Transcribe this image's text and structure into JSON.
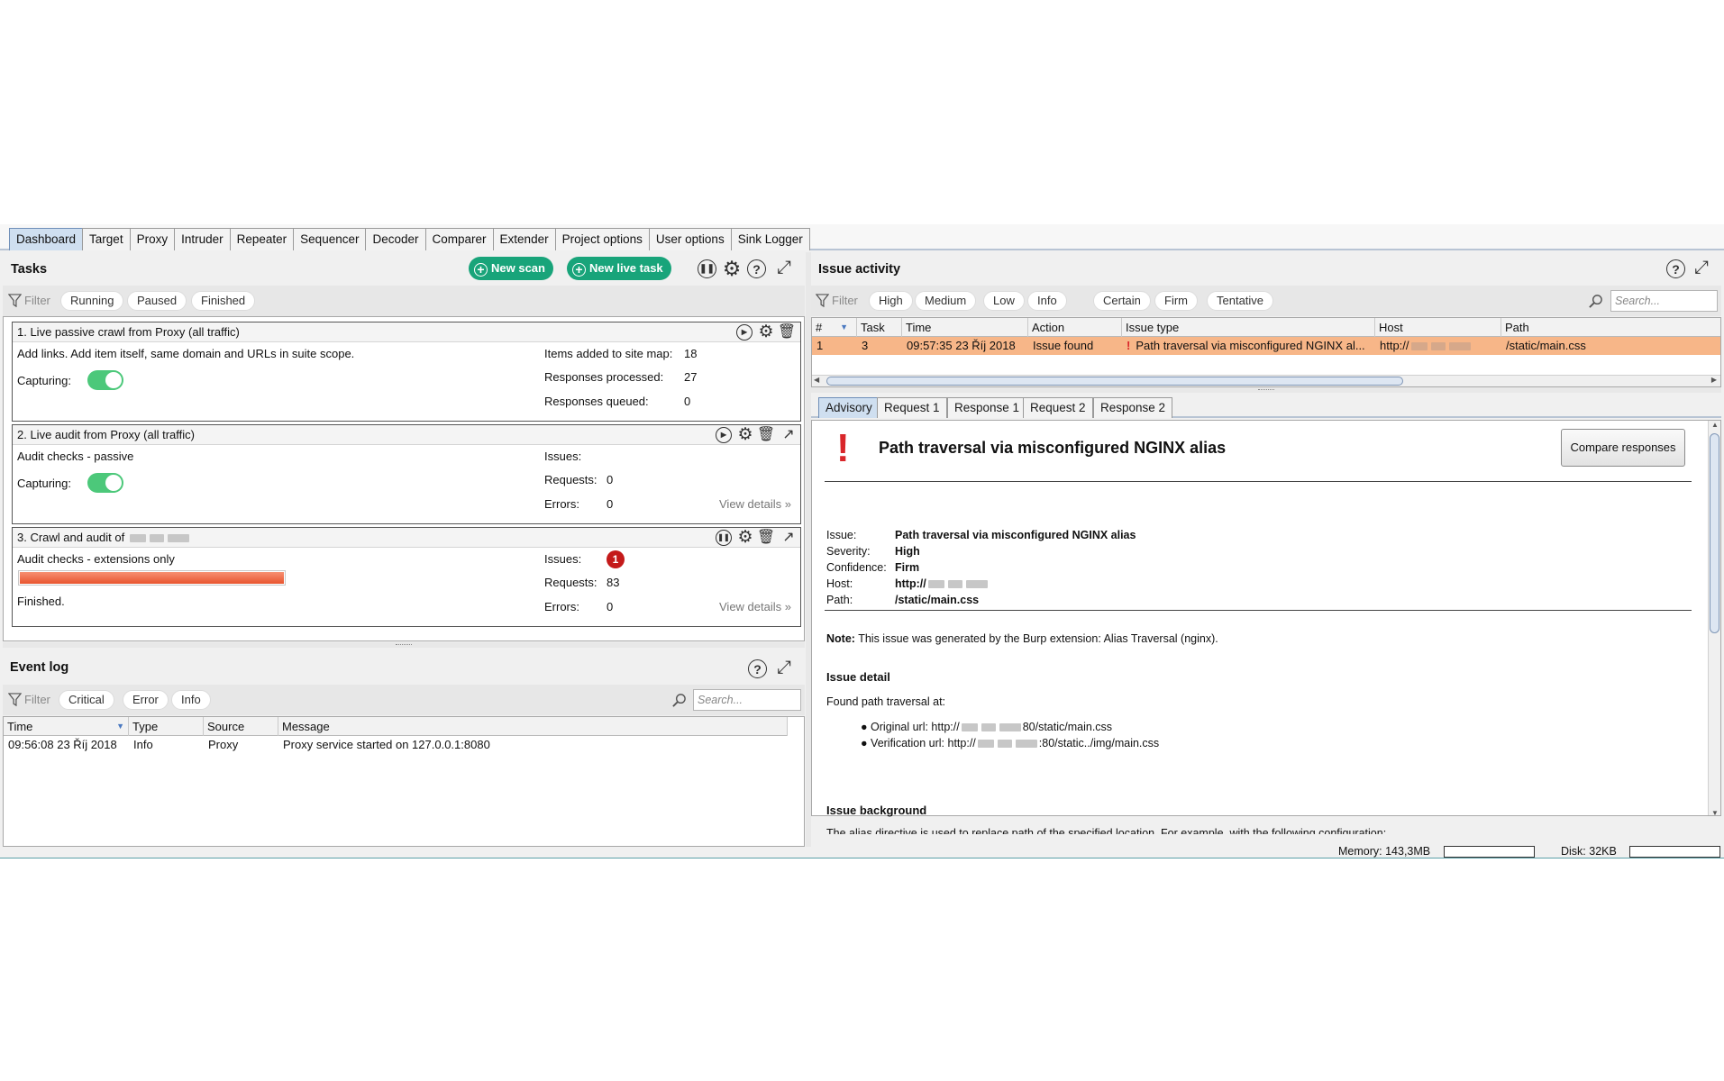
{
  "main_tabs": [
    "Dashboard",
    "Target",
    "Proxy",
    "Intruder",
    "Repeater",
    "Sequencer",
    "Decoder",
    "Comparer",
    "Extender",
    "Project options",
    "User options",
    "Sink Logger"
  ],
  "active_tab": "Dashboard",
  "tasks": {
    "title": "Tasks",
    "new_scan_label": "New scan",
    "new_live_task_label": "New live task",
    "filter_label": "Filter",
    "filters": [
      "Running",
      "Paused",
      "Finished"
    ],
    "items": [
      {
        "title": "1. Live passive crawl from Proxy (all traffic)",
        "description": "Add links. Add item itself, same domain and URLs in suite scope.",
        "capturing_label": "Capturing:",
        "capturing_on": true,
        "stats": [
          {
            "label": "Items added to site map:",
            "value": "18"
          },
          {
            "label": "Responses processed:",
            "value": "27"
          },
          {
            "label": "Responses queued:",
            "value": "0"
          }
        ]
      },
      {
        "title": "2. Live audit from Proxy (all traffic)",
        "description": "Audit checks - passive",
        "capturing_label": "Capturing:",
        "capturing_on": true,
        "stats": [
          {
            "label": "Issues:",
            "value": ""
          },
          {
            "label": "Requests:",
            "value": "0"
          },
          {
            "label": "Errors:",
            "value": "0"
          }
        ],
        "view_details": "View details"
      },
      {
        "title": "3. Crawl and audit of",
        "description": "Audit checks - extensions only",
        "progress": 1.0,
        "status": "Finished.",
        "issues_label": "Issues:",
        "issues_count": "1",
        "stats": [
          {
            "label": "Requests:",
            "value": "83"
          },
          {
            "label": "Errors:",
            "value": "0"
          }
        ],
        "view_details": "View details"
      }
    ]
  },
  "event_log": {
    "title": "Event log",
    "filter_label": "Filter",
    "filters": [
      "Critical",
      "Error",
      "Info"
    ],
    "search_placeholder": "Search...",
    "columns": [
      "Time",
      "Type",
      "Source",
      "Message"
    ],
    "rows": [
      {
        "time": "09:56:08 23 Říj 2018",
        "type": "Info",
        "source": "Proxy",
        "message": "Proxy service started on 127.0.0.1:8080"
      }
    ]
  },
  "issue_activity": {
    "title": "Issue activity",
    "filter_label": "Filter",
    "severity_filters": [
      "High",
      "Medium",
      "Low",
      "Info"
    ],
    "confidence_filters": [
      "Certain",
      "Firm",
      "Tentative"
    ],
    "search_placeholder": "Search...",
    "columns": [
      "#",
      "Task",
      "Time",
      "Action",
      "Issue type",
      "Host",
      "Path"
    ],
    "rows": [
      {
        "num": "1",
        "task": "3",
        "time": "09:57:35 23 Říj 2018",
        "action": "Issue found",
        "issue_type": "Path traversal via misconfigured NGINX al...",
        "host": "http://",
        "path": "/static/main.css"
      }
    ]
  },
  "detail_tabs": [
    "Advisory",
    "Request 1",
    "Response 1",
    "Request 2",
    "Response 2"
  ],
  "advisory": {
    "heading": "Path traversal via misconfigured NGINX alias",
    "compare_button": "Compare responses",
    "fields": [
      {
        "label": "Issue:",
        "value": "Path traversal via misconfigured NGINX alias"
      },
      {
        "label": "Severity:",
        "value": "High"
      },
      {
        "label": "Confidence:",
        "value": "Firm"
      },
      {
        "label": "Host:",
        "value": "http://"
      },
      {
        "label": "Path:",
        "value": "/static/main.css"
      }
    ],
    "note_label": "Note:",
    "note_text": "This issue was generated by the Burp extension: Alias Traversal (nginx).",
    "detail_heading": "Issue detail",
    "detail_intro": "Found path traversal at:",
    "original_url_label": "Original url: http://",
    "original_url_tail": "80/static/main.css",
    "verification_url_label": "Verification url: http://",
    "verification_url_tail": ":80/static../img/main.css",
    "background_heading": "Issue background",
    "background_text": "The alias directive is used to replace path of the specified location. For example, with the following configuration:"
  },
  "status_bar": {
    "memory_label": "Memory: 143,3MB",
    "disk_label": "Disk: 32KB"
  },
  "colors": {
    "accent_green": "#18a47a",
    "selected_row": "#f7b688",
    "severity_red": "#d9262a",
    "progress": "#f06c4c"
  }
}
